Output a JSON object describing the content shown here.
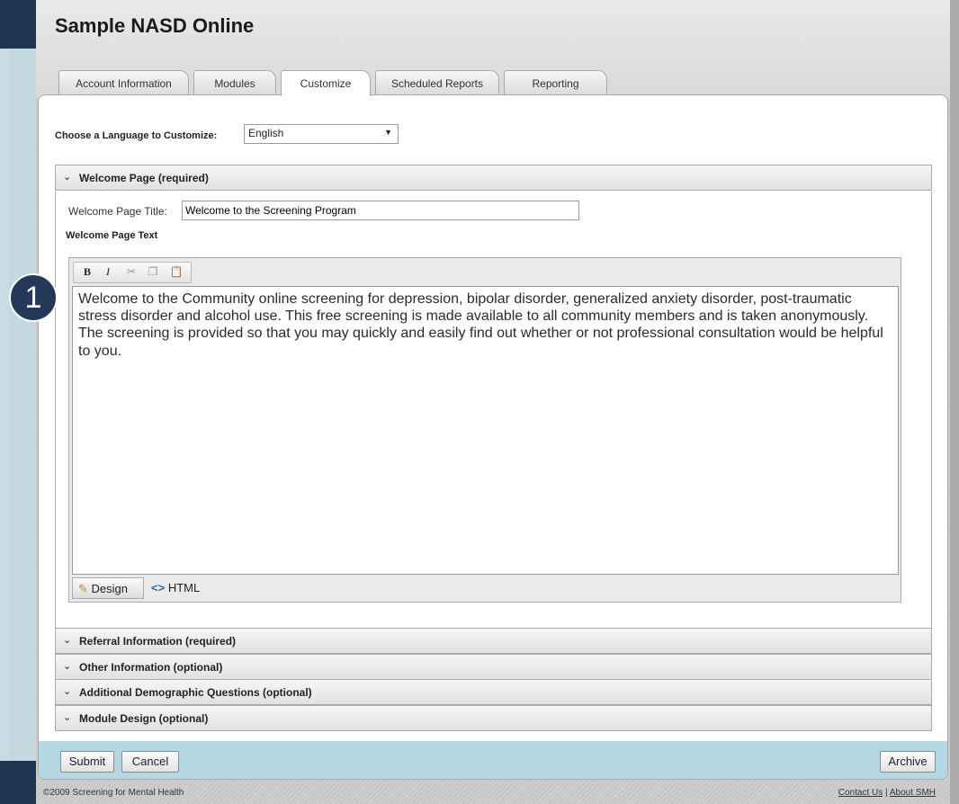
{
  "site": {
    "title": "Sample NASD Online"
  },
  "tabs": [
    {
      "label": "Account Information",
      "active": false
    },
    {
      "label": "Modules",
      "active": false
    },
    {
      "label": "Customize",
      "active": true
    },
    {
      "label": "Scheduled Reports",
      "active": false
    },
    {
      "label": "Reporting",
      "active": false
    }
  ],
  "language": {
    "label": "Choose a Language to Customize:",
    "selected": "English"
  },
  "sections": [
    {
      "title": "Welcome Page (required)",
      "expanded": true
    },
    {
      "title": "Referral Information (required)",
      "expanded": false
    },
    {
      "title": "Other Information (optional)",
      "expanded": false
    },
    {
      "title": "Additional Demographic Questions (optional)",
      "expanded": false
    },
    {
      "title": "Module Design (optional)",
      "expanded": false
    }
  ],
  "welcome": {
    "title_label": "Welcome Page Title:",
    "title_value": "Welcome to the Screening Program",
    "text_label": "Welcome Page Text",
    "editor_text": "Welcome to the Community online screening for depression, bipolar disorder, generalized anxiety disorder, post-traumatic stress disorder and alcohol use. This free screening is made available to all community members and is taken anonymously. The screening is provided so that you may quickly and easily find out whether or not professional consultation would be helpful to you.",
    "toolbar": {
      "bold": "B",
      "italic": "I",
      "cut": "✂",
      "copy": "❐",
      "paste": "📋"
    },
    "modes": {
      "design": "Design",
      "html": "HTML"
    }
  },
  "buttons": {
    "submit": "Submit",
    "cancel": "Cancel",
    "archive": "Archive"
  },
  "callout": "1",
  "footer": {
    "copyright": "©2009 Screening for Mental Health",
    "contact": "Contact Us",
    "separator": "|",
    "about": "About SMH"
  }
}
